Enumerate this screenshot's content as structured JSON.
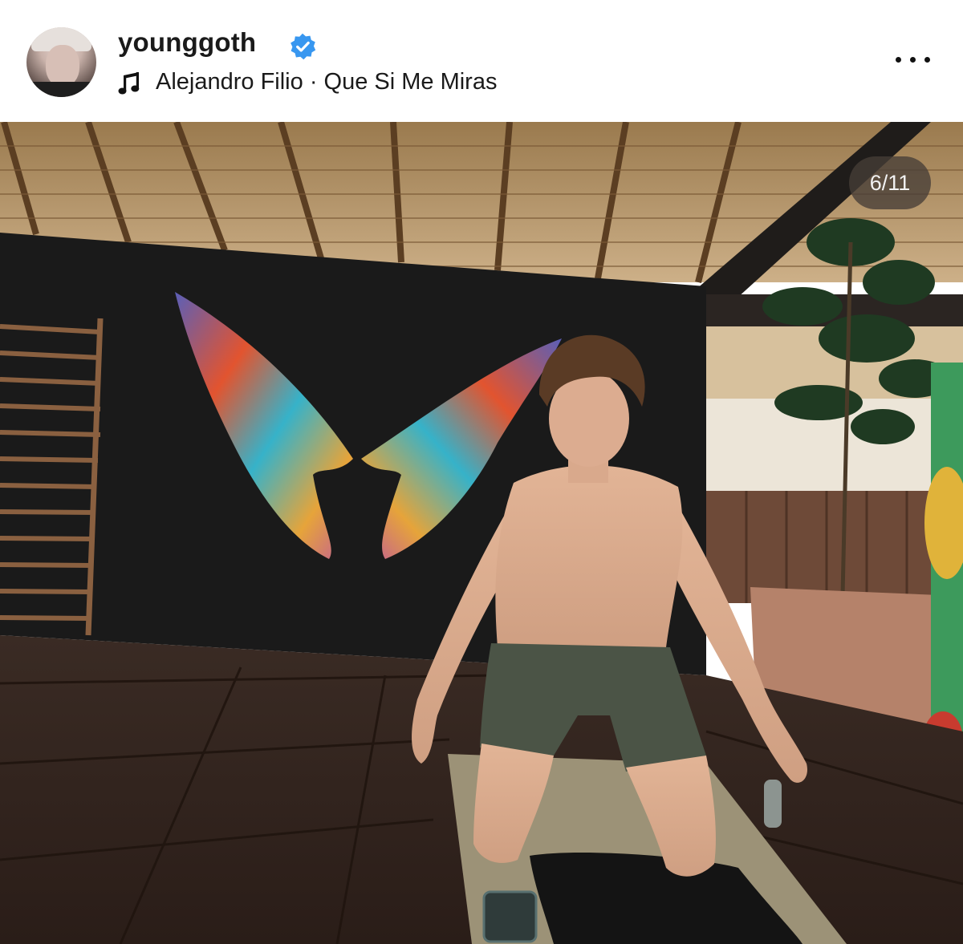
{
  "post": {
    "username": "younggoth",
    "verified": true,
    "audio": "Alejandro Filio · Que Si Me Miras",
    "carousel_position": "6/11"
  },
  "icons": {
    "verified": "verified-badge-icon",
    "music": "music-note-icon",
    "more": "more-options-icon"
  },
  "colors": {
    "verified_badge": "#3897f0",
    "counter_bg": "#463e37"
  }
}
